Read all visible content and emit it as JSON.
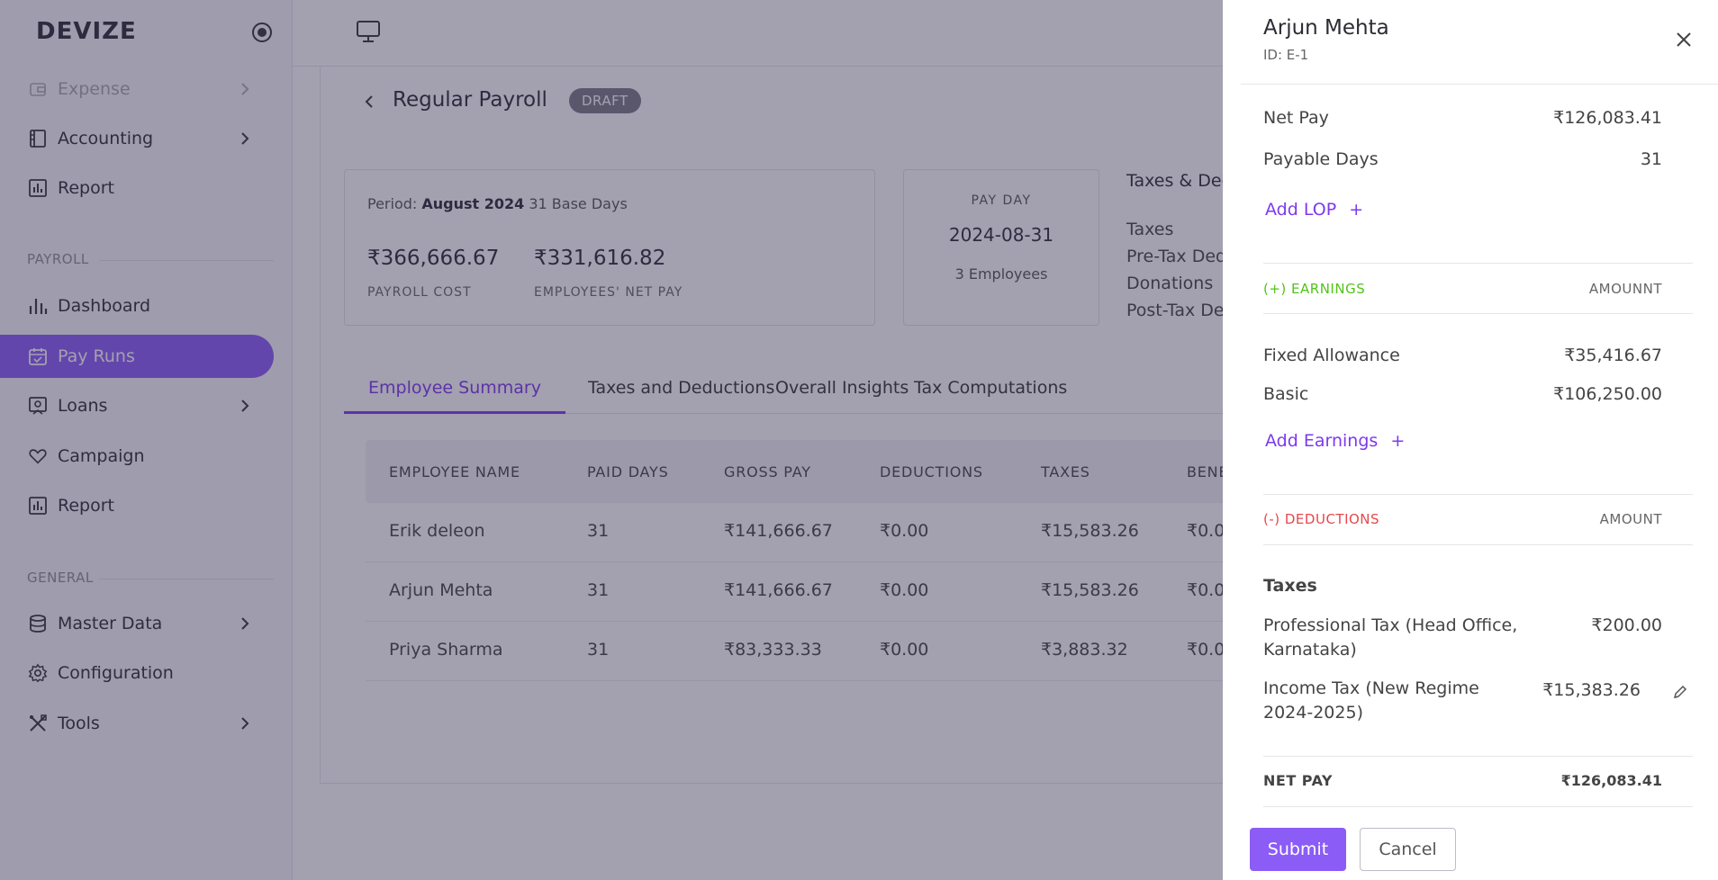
{
  "app": {
    "brand": "DEVIZE"
  },
  "sidebar": {
    "items_top": [
      {
        "label": "Expense",
        "icon": "wallet-icon",
        "chevron": true,
        "faded": true
      },
      {
        "label": "Accounting",
        "icon": "ledger-icon",
        "chevron": true
      },
      {
        "label": "Report",
        "icon": "report-icon",
        "chevron": false
      }
    ],
    "payroll_label": "PAYROLL",
    "payroll_items": [
      {
        "label": "Dashboard",
        "icon": "bar-chart-icon",
        "chevron": false
      },
      {
        "label": "Pay Runs",
        "icon": "calendar-icon",
        "chevron": false,
        "active": true
      },
      {
        "label": "Loans",
        "icon": "loan-icon",
        "chevron": true
      },
      {
        "label": "Campaign",
        "icon": "heart-icon",
        "chevron": false
      },
      {
        "label": "Report",
        "icon": "report-icon",
        "chevron": false
      }
    ],
    "general_label": "GENERAL",
    "general_items": [
      {
        "label": "Master Data",
        "icon": "database-icon",
        "chevron": true
      },
      {
        "label": "Configuration",
        "icon": "gear-icon",
        "chevron": false
      },
      {
        "label": "Tools",
        "icon": "tools-icon",
        "chevron": true
      }
    ]
  },
  "page": {
    "title": "Regular Payroll",
    "status": "DRAFT",
    "period_label": "Period:",
    "period_value": "August 2024",
    "base_days": "31 Base Days",
    "payroll_cost": "₹366,666.67",
    "payroll_cost_label": "PAYROLL COST",
    "net_pay": "₹331,616.82",
    "net_pay_label": "EMPLOYEES' NET PAY",
    "pay_day_label": "PAY DAY",
    "pay_day": "2024-08-31",
    "employee_count": "3 Employees",
    "taxes_heading": "Taxes & Ded",
    "tax_lines": [
      "Taxes",
      "Pre-Tax Ded",
      "Donations",
      "Post-Tax Ded"
    ]
  },
  "tabs": [
    "Employee Summary",
    "Taxes and Deductions",
    "Overall Insights",
    "Tax Computations"
  ],
  "table": {
    "headers": [
      "EMPLOYEE NAME",
      "PAID DAYS",
      "GROSS PAY",
      "DEDUCTIONS",
      "TAXES",
      "BENE"
    ],
    "rows": [
      [
        "Erik deleon",
        "31",
        "₹141,666.67",
        "₹0.00",
        "₹15,583.26",
        "₹0.0"
      ],
      [
        "Arjun Mehta",
        "31",
        "₹141,666.67",
        "₹0.00",
        "₹15,583.26",
        "₹0.0"
      ],
      [
        "Priya Sharma",
        "31",
        "₹83,333.33",
        "₹0.00",
        "₹3,883.32",
        "₹0.0"
      ]
    ]
  },
  "drawer": {
    "name": "Arjun Mehta",
    "id": "ID: E-1",
    "net_pay_label": "Net Pay",
    "net_pay": "₹126,083.41",
    "payable_days_label": "Payable Days",
    "payable_days": "31",
    "add_lop": "Add LOP",
    "earnings_label": "(+) EARNINGS",
    "earnings_amount_label": "AMOUNNT",
    "earnings": [
      {
        "label": "Fixed Allowance",
        "amount": "₹35,416.67"
      },
      {
        "label": "Basic",
        "amount": "₹106,250.00"
      }
    ],
    "add_earnings": "Add Earnings",
    "deductions_label": "(-) DEDUCTIONS",
    "deductions_amount_label": "AMOUNT",
    "taxes_label": "Taxes",
    "taxes": [
      {
        "label": "Professional Tax (Head Office, Karnataka)",
        "amount": "₹200.00"
      },
      {
        "label": "Income Tax (New Regime 2024-2025)",
        "amount": "₹15,383.26"
      }
    ],
    "total_label": "NET PAY",
    "total": "₹126,083.41",
    "submit": "Submit",
    "cancel": "Cancel"
  },
  "colors": {
    "accent": "#8b5cf6",
    "earnings": "#52c41a",
    "deductions": "#e5484d",
    "overlay": "#322d50"
  }
}
